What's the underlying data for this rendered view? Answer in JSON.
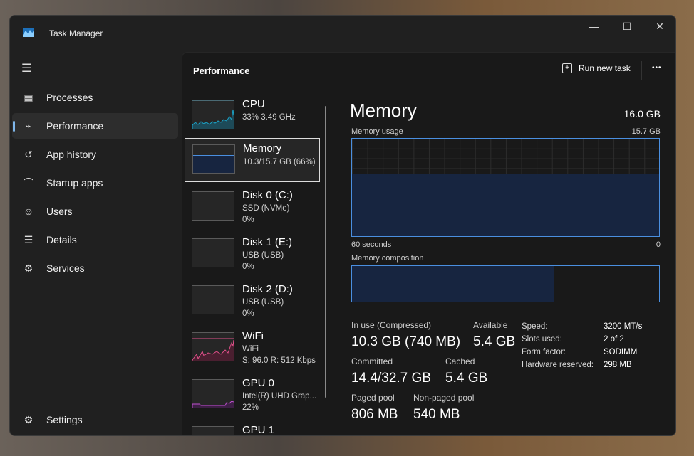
{
  "window": {
    "title": "Task Manager",
    "minimize": "—",
    "maximize": "☐",
    "close": "✕"
  },
  "sidebar": {
    "items": [
      {
        "label": "Processes",
        "icon": "▦"
      },
      {
        "label": "Performance",
        "icon": "⌁"
      },
      {
        "label": "App history",
        "icon": "↺"
      },
      {
        "label": "Startup apps",
        "icon": "⌒"
      },
      {
        "label": "Users",
        "icon": "☺"
      },
      {
        "label": "Details",
        "icon": "☰"
      },
      {
        "label": "Services",
        "icon": "⚙"
      }
    ],
    "settings": "Settings",
    "menu_icon": "☰"
  },
  "header": {
    "title": "Performance",
    "run_new_task": "Run new task",
    "more": "•••"
  },
  "devices": [
    {
      "name": "CPU",
      "line1": "33%  3.49 GHz",
      "line2": "",
      "line3": ""
    },
    {
      "name": "Memory",
      "line1": "10.3/15.7 GB (66%)"
    },
    {
      "name": "Disk 0 (C:)",
      "line1": "SSD (NVMe)",
      "line2": "0%"
    },
    {
      "name": "Disk 1 (E:)",
      "line1": "USB (USB)",
      "line2": "0%"
    },
    {
      "name": "Disk 2 (D:)",
      "line1": "USB (USB)",
      "line2": "0%"
    },
    {
      "name": "WiFi",
      "line1": "WiFi",
      "line2": "S: 96.0  R: 512 Kbps"
    },
    {
      "name": "GPU 0",
      "line1": "Intel(R) UHD Grap...",
      "line2": "22%"
    },
    {
      "name": "GPU 1"
    }
  ],
  "detail": {
    "title": "Memory",
    "total": "16.0 GB",
    "usage_label": "Memory usage",
    "usage_max": "15.7 GB",
    "time_left": "60 seconds",
    "time_right": "0",
    "usage_fraction": 0.64,
    "composition_label": "Memory composition",
    "in_use_fraction": 0.66,
    "stats": {
      "in_use_label": "In use (Compressed)",
      "in_use": "10.3 GB (740 MB)",
      "available_label": "Available",
      "available": "5.4 GB",
      "committed_label": "Committed",
      "committed": "14.4/32.7 GB",
      "cached_label": "Cached",
      "cached": "5.4 GB",
      "paged_label": "Paged pool",
      "paged": "806 MB",
      "nonpaged_label": "Non-paged pool",
      "nonpaged": "540 MB"
    },
    "props": [
      {
        "k": "Speed:",
        "v": "3200 MT/s"
      },
      {
        "k": "Slots used:",
        "v": "2 of 2"
      },
      {
        "k": "Form factor:",
        "v": "SODIMM"
      },
      {
        "k": "Hardware reserved:",
        "v": "298 MB"
      }
    ]
  },
  "colors": {
    "memory": "#4a8fe0",
    "cpu": "#1aa3c8",
    "wifi": "#e0508a",
    "gpu": "#c050d0"
  }
}
